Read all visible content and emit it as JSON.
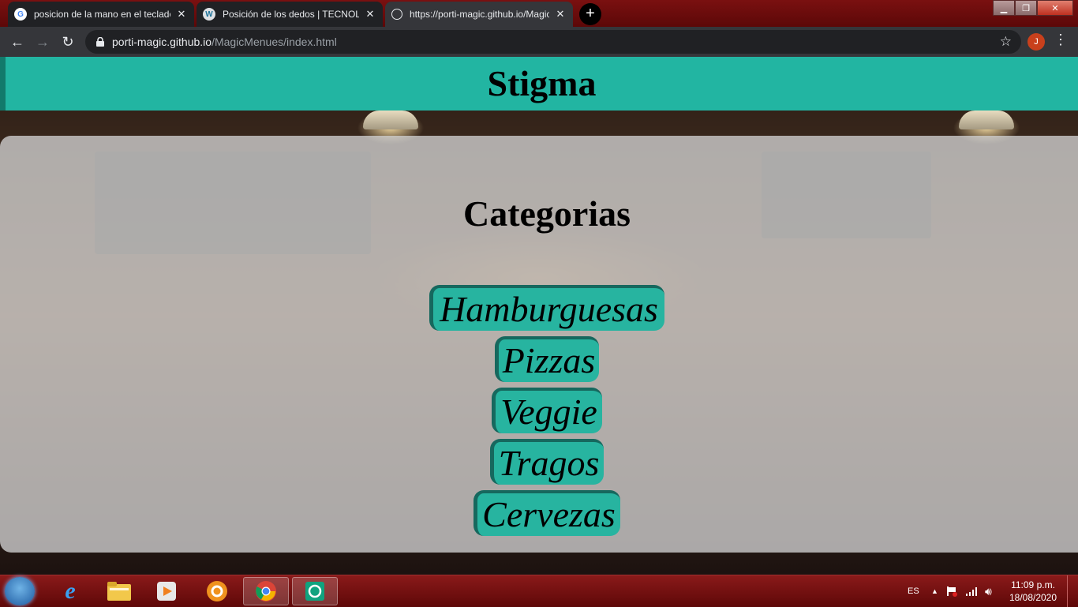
{
  "browser": {
    "tabs": [
      {
        "title": "posicion de la mano en el teclado",
        "favicon": "google-icon",
        "active": false
      },
      {
        "title": "Posición de los dedos | TECNOLOGIA",
        "favicon": "wordpress-icon",
        "active": false
      },
      {
        "title": "https://porti-magic.github.io/MagicMenues/index.html",
        "favicon": "globe-icon",
        "active": true
      }
    ],
    "new_tab": "+",
    "url_host": "porti-magic.github.io",
    "url_path": "/MagicMenues/index.html",
    "profile_initial": "J"
  },
  "page": {
    "site_title": "Stigma",
    "section_title": "Categorias",
    "categories": [
      "Hamburguesas",
      "Pizzas",
      "Veggie",
      "Tragos",
      "Cervezas"
    ]
  },
  "taskbar": {
    "language": "ES",
    "time": "11:09 p.m.",
    "date": "18/08/2020"
  },
  "colors": {
    "accent": "#22b5a2",
    "accent_dark": "#16685e",
    "browser_dark": "#35363a"
  }
}
